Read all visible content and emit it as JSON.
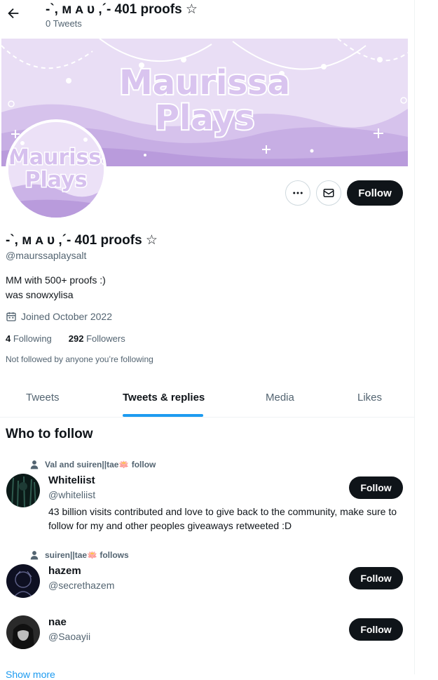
{
  "header": {
    "title": "-`, ᴍ ᴀ ᴜ ,´- 401 proofs ☆",
    "subtitle": "0 Tweets"
  },
  "banner": {
    "line1": "Maurissa",
    "line2": "Plays"
  },
  "avatar": {
    "line1": "Maurissa",
    "line2": "Plays"
  },
  "actions": {
    "follow_label": "Follow"
  },
  "profile": {
    "name": "-`, ᴍ ᴀ ᴜ ,´- 401 proofs ☆",
    "handle": "@maurssaplaysalt",
    "bio_line1": "MM with 500+ proofs :)",
    "bio_line2": "was snowxylisa",
    "joined": "Joined October 2022",
    "following_count": "4",
    "following_label": "Following",
    "followers_count": "292",
    "followers_label": "Followers",
    "mutuals_note": "Not followed by anyone you’re following"
  },
  "tabs": [
    {
      "label": "Tweets"
    },
    {
      "label": "Tweets & replies"
    },
    {
      "label": "Media"
    },
    {
      "label": "Likes"
    }
  ],
  "who_to_follow": {
    "title": "Who to follow",
    "show_more": "Show more",
    "users": [
      {
        "social_context": "Val and suiren||tae🪷 follow",
        "name": "Whiteliist",
        "handle": "@whiteliist",
        "bio": "43 billion visits contributed and love to give back to the community, make sure to follow for my and other peoples giveaways retweeted :D",
        "follow_label": "Follow"
      },
      {
        "social_context": "suiren||tae🪷 follows",
        "name": "hazem",
        "handle": "@secrethazem",
        "bio": "",
        "follow_label": "Follow"
      },
      {
        "social_context": "",
        "name": "nae",
        "handle": "@Saoayii",
        "bio": "",
        "follow_label": "Follow"
      }
    ]
  },
  "colors": {
    "accent": "#1d9bf0",
    "banner_purple": "#e6d9f4",
    "text_secondary": "#536471"
  }
}
